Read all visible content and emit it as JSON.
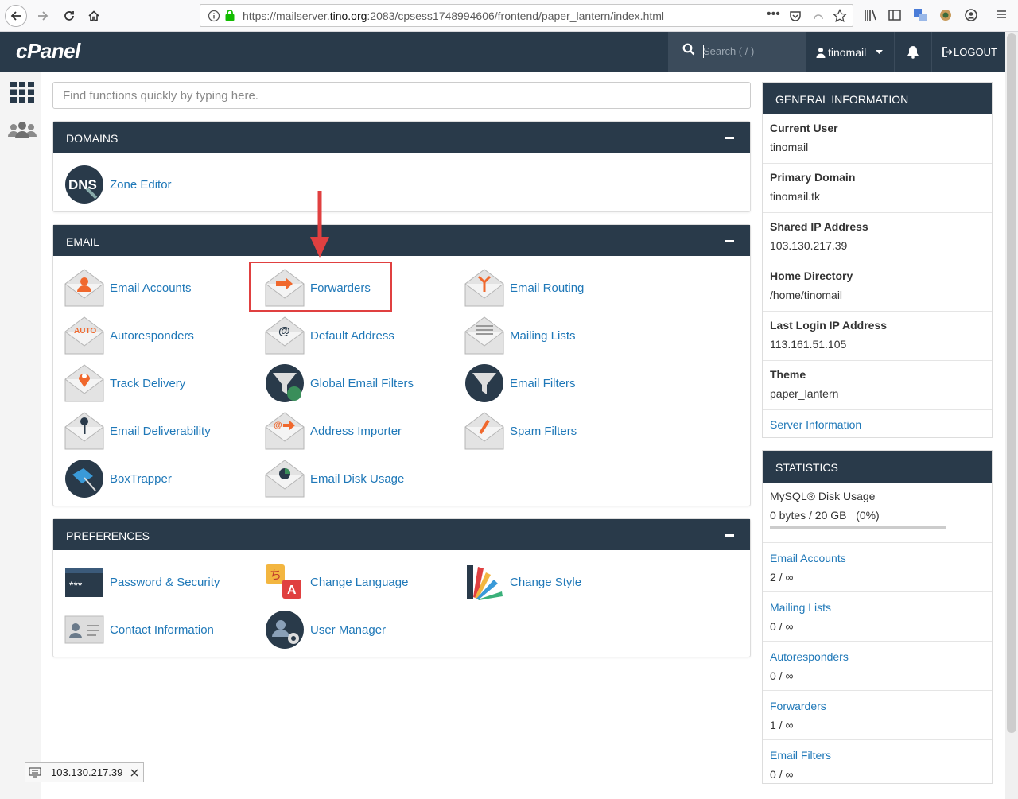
{
  "browser": {
    "url_prefix": "https://mailserver.",
    "url_domain": "tino.org",
    "url_suffix": ":2083/cpsess1748994606/frontend/paper_lantern/index.html"
  },
  "header": {
    "logo": "cPanel",
    "search_placeholder": "Search ( / )",
    "username": "tinomail",
    "logout": "LOGOUT"
  },
  "find": {
    "placeholder": "Find functions quickly by typing here."
  },
  "domains": {
    "title": "DOMAINS",
    "items": [
      {
        "label": "Zone Editor"
      }
    ]
  },
  "email": {
    "title": "EMAIL",
    "items": [
      {
        "label": "Email Accounts"
      },
      {
        "label": "Forwarders"
      },
      {
        "label": "Email Routing"
      },
      {
        "label": "Autoresponders"
      },
      {
        "label": "Default Address"
      },
      {
        "label": "Mailing Lists"
      },
      {
        "label": "Track Delivery"
      },
      {
        "label": "Global Email Filters"
      },
      {
        "label": "Email Filters"
      },
      {
        "label": "Email Deliverability"
      },
      {
        "label": "Address Importer"
      },
      {
        "label": "Spam Filters"
      },
      {
        "label": "BoxTrapper"
      },
      {
        "label": "Email Disk Usage"
      }
    ]
  },
  "preferences": {
    "title": "PREFERENCES",
    "items": [
      {
        "label": "Password & Security"
      },
      {
        "label": "Change Language"
      },
      {
        "label": "Change Style"
      },
      {
        "label": "Contact Information"
      },
      {
        "label": "User Manager"
      }
    ]
  },
  "general": {
    "title": "GENERAL INFORMATION",
    "rows": [
      {
        "label": "Current User",
        "value": "tinomail"
      },
      {
        "label": "Primary Domain",
        "value": "tinomail.tk"
      },
      {
        "label": "Shared IP Address",
        "value": "103.130.217.39"
      },
      {
        "label": "Home Directory",
        "value": "/home/tinomail"
      },
      {
        "label": "Last Login IP Address",
        "value": "113.161.51.105"
      },
      {
        "label": "Theme",
        "value": "paper_lantern"
      }
    ],
    "server_info": "Server Information"
  },
  "statistics": {
    "title": "STATISTICS",
    "mysql_label": "MySQL® Disk Usage",
    "mysql_value": "0 bytes / 20 GB   (0%)",
    "mysql_fraction": 0,
    "rows": [
      {
        "label": "Email Accounts",
        "value": "2 / ∞"
      },
      {
        "label": "Mailing Lists",
        "value": "0 / ∞"
      },
      {
        "label": "Autoresponders",
        "value": "0 / ∞"
      },
      {
        "label": "Forwarders",
        "value": "1 / ∞"
      },
      {
        "label": "Email Filters",
        "value": "0 / ∞"
      }
    ]
  },
  "status_tip": "103.130.217.39",
  "colors": {
    "header": "#293a4a",
    "link": "#1f78b8",
    "highlight": "#e04040"
  }
}
